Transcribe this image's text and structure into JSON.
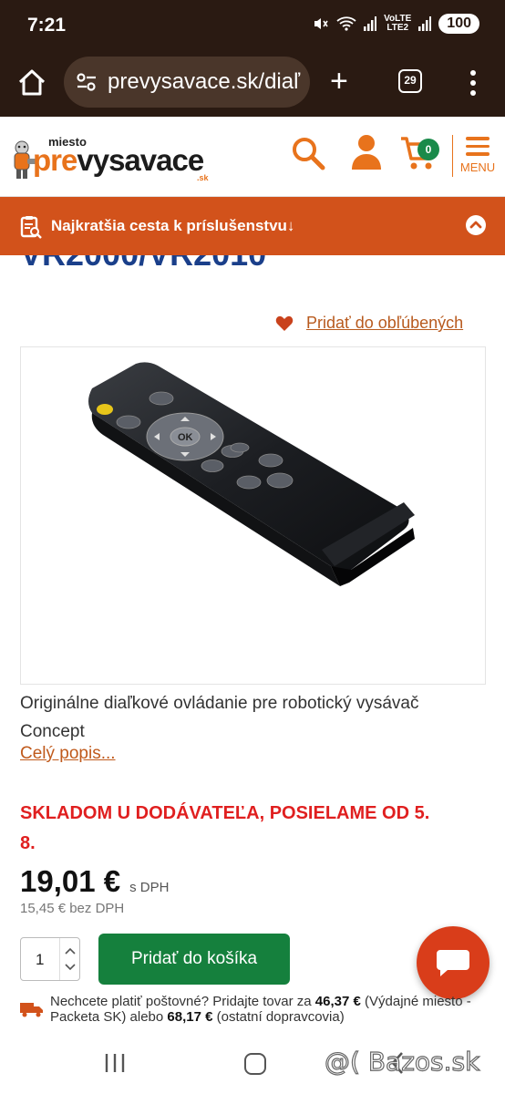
{
  "status_bar": {
    "time": "7:21",
    "battery": "100",
    "network": "LTE2",
    "volte": "VoLTE"
  },
  "browser": {
    "url": "prevysavace.sk/diaľ",
    "tab_count": "29",
    "new_tab": "+"
  },
  "site": {
    "logo_miesto": "miesto",
    "logo_pre": "pre",
    "logo_vysavace": "vysavace",
    "logo_sk": ".sk",
    "cart_count": "0",
    "menu_label": "MENU"
  },
  "banner": {
    "text": "Najkratšia cesta k príslušenstvu↓"
  },
  "product": {
    "title": "VR2000/VR2010",
    "favourite_label": "Pridať do obľúbených",
    "description": "Originálne diaľkové ovládanie pre robotický vysávač Concept",
    "more_link": "Celý popis...",
    "stock": "SKLADOM U DODÁVATEĽA, POSIELAME OD 5. 8.",
    "price": "19,01 €",
    "price_vat_label": "s DPH",
    "price_net": "15,45 € bez DPH",
    "quantity": "1",
    "add_to_cart": "Pridať do košíka"
  },
  "shipping": {
    "prefix": "Nechcete platiť poštovné? Pridajte tovar za ",
    "amount1": "46,37 €",
    "middle": " (Výdajné miesto - Packeta SK) alebo ",
    "amount2": "68,17 €",
    "suffix": " (ostatní dopravcovia)"
  },
  "remote_buttons": {
    "ok": "OK"
  },
  "watermark": "@( Bazos.sk",
  "colors": {
    "brand_orange": "#e8731c",
    "banner": "#d2521b",
    "add_to_cart": "#15803d",
    "stock_red": "#e01f1f",
    "title_blue": "#1a3f8a",
    "chat": "#d93d1a"
  }
}
